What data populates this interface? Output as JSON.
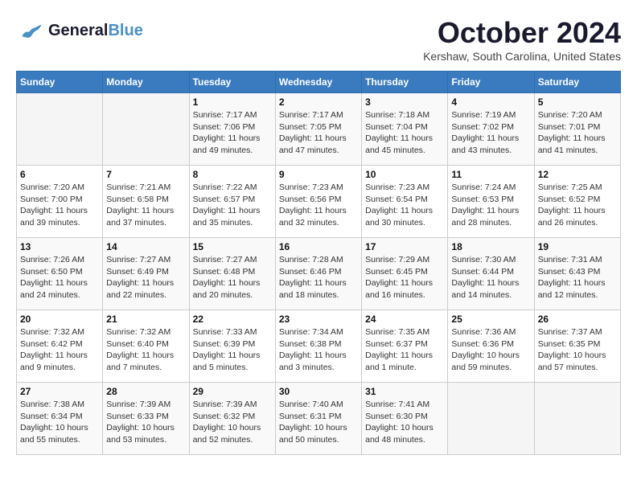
{
  "header": {
    "logo_general": "General",
    "logo_blue": "Blue",
    "month_title": "October 2024",
    "location": "Kershaw, South Carolina, United States"
  },
  "days_of_week": [
    "Sunday",
    "Monday",
    "Tuesday",
    "Wednesday",
    "Thursday",
    "Friday",
    "Saturday"
  ],
  "weeks": [
    [
      {
        "day": "",
        "info": ""
      },
      {
        "day": "",
        "info": ""
      },
      {
        "day": "1",
        "sunrise": "Sunrise: 7:17 AM",
        "sunset": "Sunset: 7:06 PM",
        "daylight": "Daylight: 11 hours and 49 minutes."
      },
      {
        "day": "2",
        "sunrise": "Sunrise: 7:17 AM",
        "sunset": "Sunset: 7:05 PM",
        "daylight": "Daylight: 11 hours and 47 minutes."
      },
      {
        "day": "3",
        "sunrise": "Sunrise: 7:18 AM",
        "sunset": "Sunset: 7:04 PM",
        "daylight": "Daylight: 11 hours and 45 minutes."
      },
      {
        "day": "4",
        "sunrise": "Sunrise: 7:19 AM",
        "sunset": "Sunset: 7:02 PM",
        "daylight": "Daylight: 11 hours and 43 minutes."
      },
      {
        "day": "5",
        "sunrise": "Sunrise: 7:20 AM",
        "sunset": "Sunset: 7:01 PM",
        "daylight": "Daylight: 11 hours and 41 minutes."
      }
    ],
    [
      {
        "day": "6",
        "sunrise": "Sunrise: 7:20 AM",
        "sunset": "Sunset: 7:00 PM",
        "daylight": "Daylight: 11 hours and 39 minutes."
      },
      {
        "day": "7",
        "sunrise": "Sunrise: 7:21 AM",
        "sunset": "Sunset: 6:58 PM",
        "daylight": "Daylight: 11 hours and 37 minutes."
      },
      {
        "day": "8",
        "sunrise": "Sunrise: 7:22 AM",
        "sunset": "Sunset: 6:57 PM",
        "daylight": "Daylight: 11 hours and 35 minutes."
      },
      {
        "day": "9",
        "sunrise": "Sunrise: 7:23 AM",
        "sunset": "Sunset: 6:56 PM",
        "daylight": "Daylight: 11 hours and 32 minutes."
      },
      {
        "day": "10",
        "sunrise": "Sunrise: 7:23 AM",
        "sunset": "Sunset: 6:54 PM",
        "daylight": "Daylight: 11 hours and 30 minutes."
      },
      {
        "day": "11",
        "sunrise": "Sunrise: 7:24 AM",
        "sunset": "Sunset: 6:53 PM",
        "daylight": "Daylight: 11 hours and 28 minutes."
      },
      {
        "day": "12",
        "sunrise": "Sunrise: 7:25 AM",
        "sunset": "Sunset: 6:52 PM",
        "daylight": "Daylight: 11 hours and 26 minutes."
      }
    ],
    [
      {
        "day": "13",
        "sunrise": "Sunrise: 7:26 AM",
        "sunset": "Sunset: 6:50 PM",
        "daylight": "Daylight: 11 hours and 24 minutes."
      },
      {
        "day": "14",
        "sunrise": "Sunrise: 7:27 AM",
        "sunset": "Sunset: 6:49 PM",
        "daylight": "Daylight: 11 hours and 22 minutes."
      },
      {
        "day": "15",
        "sunrise": "Sunrise: 7:27 AM",
        "sunset": "Sunset: 6:48 PM",
        "daylight": "Daylight: 11 hours and 20 minutes."
      },
      {
        "day": "16",
        "sunrise": "Sunrise: 7:28 AM",
        "sunset": "Sunset: 6:46 PM",
        "daylight": "Daylight: 11 hours and 18 minutes."
      },
      {
        "day": "17",
        "sunrise": "Sunrise: 7:29 AM",
        "sunset": "Sunset: 6:45 PM",
        "daylight": "Daylight: 11 hours and 16 minutes."
      },
      {
        "day": "18",
        "sunrise": "Sunrise: 7:30 AM",
        "sunset": "Sunset: 6:44 PM",
        "daylight": "Daylight: 11 hours and 14 minutes."
      },
      {
        "day": "19",
        "sunrise": "Sunrise: 7:31 AM",
        "sunset": "Sunset: 6:43 PM",
        "daylight": "Daylight: 11 hours and 12 minutes."
      }
    ],
    [
      {
        "day": "20",
        "sunrise": "Sunrise: 7:32 AM",
        "sunset": "Sunset: 6:42 PM",
        "daylight": "Daylight: 11 hours and 9 minutes."
      },
      {
        "day": "21",
        "sunrise": "Sunrise: 7:32 AM",
        "sunset": "Sunset: 6:40 PM",
        "daylight": "Daylight: 11 hours and 7 minutes."
      },
      {
        "day": "22",
        "sunrise": "Sunrise: 7:33 AM",
        "sunset": "Sunset: 6:39 PM",
        "daylight": "Daylight: 11 hours and 5 minutes."
      },
      {
        "day": "23",
        "sunrise": "Sunrise: 7:34 AM",
        "sunset": "Sunset: 6:38 PM",
        "daylight": "Daylight: 11 hours and 3 minutes."
      },
      {
        "day": "24",
        "sunrise": "Sunrise: 7:35 AM",
        "sunset": "Sunset: 6:37 PM",
        "daylight": "Daylight: 11 hours and 1 minute."
      },
      {
        "day": "25",
        "sunrise": "Sunrise: 7:36 AM",
        "sunset": "Sunset: 6:36 PM",
        "daylight": "Daylight: 10 hours and 59 minutes."
      },
      {
        "day": "26",
        "sunrise": "Sunrise: 7:37 AM",
        "sunset": "Sunset: 6:35 PM",
        "daylight": "Daylight: 10 hours and 57 minutes."
      }
    ],
    [
      {
        "day": "27",
        "sunrise": "Sunrise: 7:38 AM",
        "sunset": "Sunset: 6:34 PM",
        "daylight": "Daylight: 10 hours and 55 minutes."
      },
      {
        "day": "28",
        "sunrise": "Sunrise: 7:39 AM",
        "sunset": "Sunset: 6:33 PM",
        "daylight": "Daylight: 10 hours and 53 minutes."
      },
      {
        "day": "29",
        "sunrise": "Sunrise: 7:39 AM",
        "sunset": "Sunset: 6:32 PM",
        "daylight": "Daylight: 10 hours and 52 minutes."
      },
      {
        "day": "30",
        "sunrise": "Sunrise: 7:40 AM",
        "sunset": "Sunset: 6:31 PM",
        "daylight": "Daylight: 10 hours and 50 minutes."
      },
      {
        "day": "31",
        "sunrise": "Sunrise: 7:41 AM",
        "sunset": "Sunset: 6:30 PM",
        "daylight": "Daylight: 10 hours and 48 minutes."
      },
      {
        "day": "",
        "info": ""
      },
      {
        "day": "",
        "info": ""
      }
    ]
  ]
}
